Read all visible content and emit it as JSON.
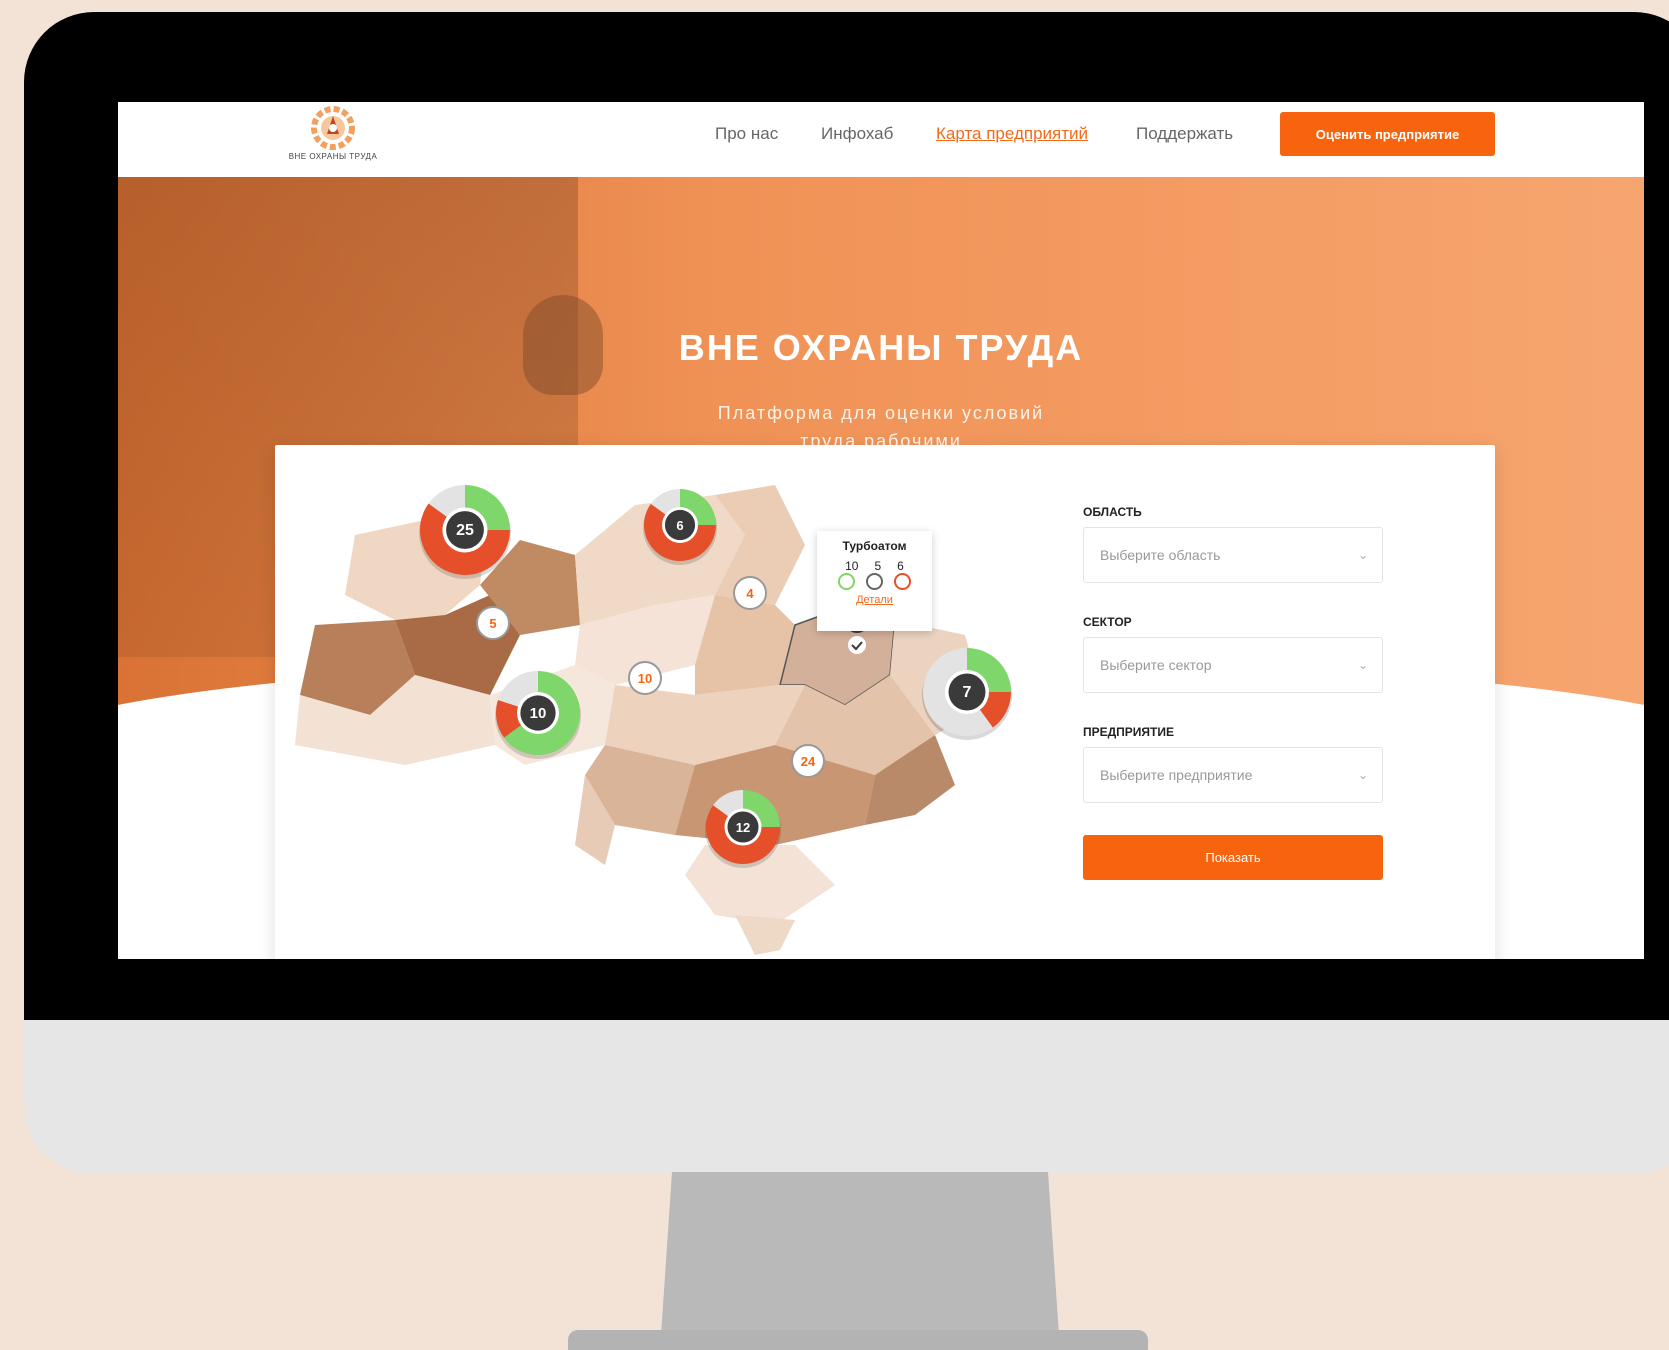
{
  "brand": {
    "name": "ВНЕ ОХРАНЫ ТРУДА"
  },
  "nav": {
    "items": [
      {
        "label": "Про нас"
      },
      {
        "label": "Инфохаб"
      },
      {
        "label": "Карта предприятий",
        "active": true
      },
      {
        "label": "Поддержать"
      }
    ],
    "cta_label": "Оценить  предприятие"
  },
  "hero": {
    "title": "ВНЕ ОХРАНЫ ТРУДА",
    "subtitle_line1": "Платформа для оценки условий",
    "subtitle_line2": "труда рабочими"
  },
  "map": {
    "clusters": [
      {
        "count": "25",
        "type": "donut",
        "green": 0.25,
        "gray": 0.15,
        "red": 0.6
      },
      {
        "count": "6",
        "type": "donut",
        "green": 0.25,
        "gray": 0.15,
        "red": 0.6
      },
      {
        "count": "10",
        "type": "donut",
        "green": 0.65,
        "gray": 0.2,
        "red": 0.15
      },
      {
        "count": "7",
        "type": "donut",
        "green": 0.25,
        "gray": 0.6,
        "red": 0.15
      },
      {
        "count": "12",
        "type": "donut",
        "green": 0.25,
        "gray": 0.15,
        "red": 0.6
      },
      {
        "count": "4",
        "type": "small"
      },
      {
        "count": "5",
        "type": "small"
      },
      {
        "count": "10",
        "type": "small"
      },
      {
        "count": "24",
        "type": "small"
      }
    ],
    "tooltip": {
      "title": "Турбоатом",
      "positive": "10",
      "neutral": "5",
      "negative": "6",
      "details_link": "Детали"
    }
  },
  "filters": {
    "region_label": "ОБЛАСТЬ",
    "region_placeholder": "Выберите область",
    "sector_label": "СЕКТОР",
    "sector_placeholder": "Выберите сектор",
    "enterprise_label": "ПРЕДПРИЯТИЕ",
    "enterprise_placeholder": "Выберите предприятие",
    "submit_label": "Показать"
  },
  "colors": {
    "accent": "#f8640e",
    "green": "#7fd66a",
    "red": "#e5502a",
    "gray": "#e3e3e3",
    "dark": "#3a3a3a"
  },
  "icons": [
    "logo-icon",
    "chevron-down-icon",
    "smile-icon",
    "neutral-face-icon",
    "sad-face-icon",
    "map-pin-icon"
  ]
}
